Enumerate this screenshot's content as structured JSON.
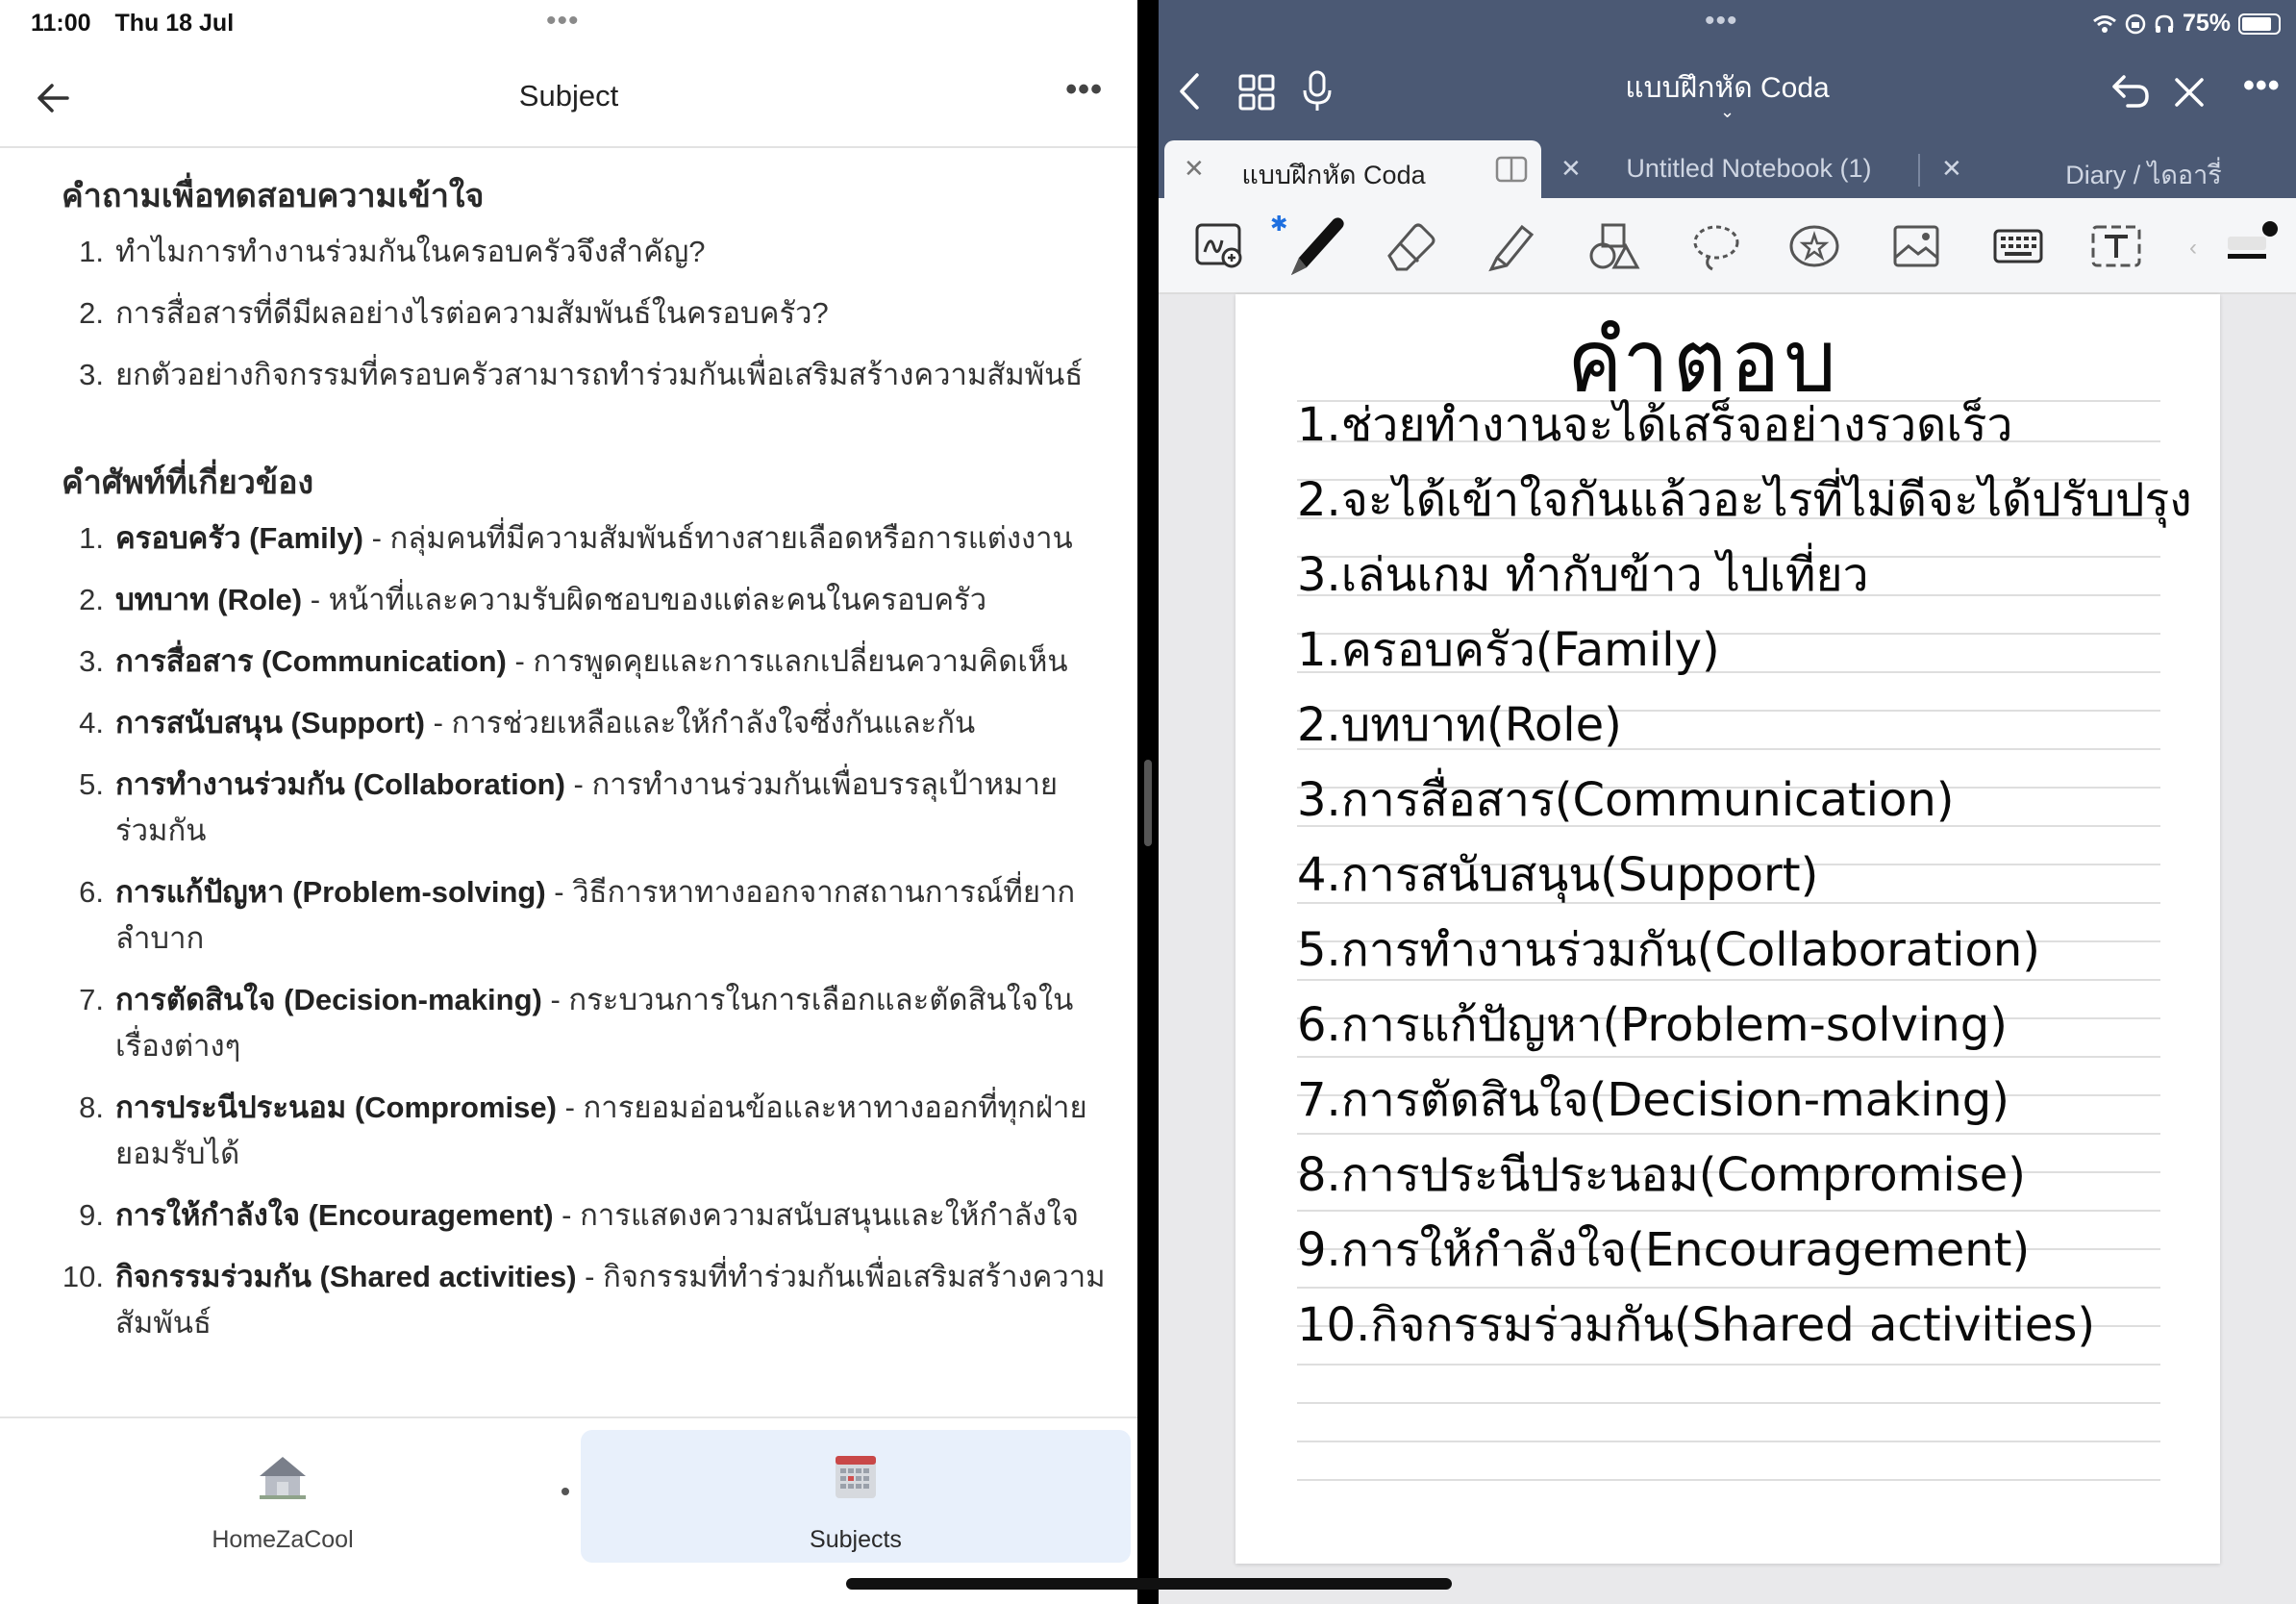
{
  "status_bar": {
    "time": "11:00",
    "date": "Thu 18 Jul",
    "battery": "75%"
  },
  "left_app": {
    "title": "Subject",
    "questions_heading": "คำถามเพื่อทดสอบความเข้าใจ",
    "questions": [
      {
        "num": "1.",
        "text": "ทำไมการทำงานร่วมกันในครอบครัวจึงสำคัญ?"
      },
      {
        "num": "2.",
        "text": "การสื่อสารที่ดีมีผลอย่างไรต่อความสัมพันธ์ในครอบครัว?"
      },
      {
        "num": "3.",
        "text": "ยกตัวอย่างกิจกรรมที่ครอบครัวสามารถทำร่วมกันเพื่อเสริมสร้างความสัมพันธ์"
      }
    ],
    "vocab_heading": "คำศัพท์ที่เกี่ยวข้อง",
    "vocab": [
      {
        "num": "1.",
        "term": "ครอบครัว (Family)",
        "def": " - กลุ่มคนที่มีความสัมพันธ์ทางสายเลือดหรือการแต่งงาน"
      },
      {
        "num": "2.",
        "term": "บทบาท (Role)",
        "def": " - หน้าที่และความรับผิดชอบของแต่ละคนในครอบครัว"
      },
      {
        "num": "3.",
        "term": "การสื่อสาร (Communication)",
        "def": " - การพูดคุยและการแลกเปลี่ยนความคิดเห็น"
      },
      {
        "num": "4.",
        "term": "การสนับสนุน (Support)",
        "def": " - การช่วยเหลือและให้กำลังใจซึ่งกันและกัน"
      },
      {
        "num": "5.",
        "term": "การทำงานร่วมกัน (Collaboration)",
        "def": " - การทำงานร่วมกันเพื่อบรรลุเป้าหมายร่วมกัน"
      },
      {
        "num": "6.",
        "term": "การแก้ปัญหา (Problem-solving)",
        "def": " - วิธีการหาทางออกจากสถานการณ์ที่ยากลำบาก"
      },
      {
        "num": "7.",
        "term": "การตัดสินใจ (Decision-making)",
        "def": " - กระบวนการในการเลือกและตัดสินใจในเรื่องต่างๆ"
      },
      {
        "num": "8.",
        "term": "การประนีประนอม (Compromise)",
        "def": " - การยอมอ่อนข้อและหาทางออกที่ทุกฝ่ายยอมรับได้"
      },
      {
        "num": "9.",
        "term": "การให้กำลังใจ (Encouragement)",
        "def": " - การแสดงความสนับสนุนและให้กำลังใจ"
      },
      {
        "num": "10.",
        "term": "กิจกรรมร่วมกัน (Shared activities)",
        "def": " - กิจกรรมที่ทำร่วมกันเพื่อเสริมสร้างความสัมพันธ์"
      }
    ],
    "tabbar": {
      "home_label": "HomeZaCool",
      "subjects_label": "Subjects"
    }
  },
  "right_app": {
    "notebook_title": "แบบฝึกหัด Coda",
    "tabs": [
      {
        "label": "แบบฝึกหัด Coda",
        "active": true
      },
      {
        "label": "Untitled Notebook (1)",
        "active": false
      },
      {
        "label": "Diary / ไดอารี่",
        "active": false
      }
    ],
    "handwriting_title": "คำตอบ",
    "handwriting_lines": [
      "1.ช่วยทำงานจะได้เสร็จอย่างรวดเร็ว",
      "2.จะได้เข้าใจกันแล้วอะไรที่ไม่ดีจะได้ปรับปรุง",
      "3.เล่นเกม   ทำกับข้าว  ไปเที่ยว",
      "1.ครอบครัว(Family)",
      "2.บทบาท(Role)",
      "3.การสื่อสาร(Communication)",
      "4.การสนับสนุน(Support)",
      "5.การทำงานร่วมกัน(Collaboration)",
      "6.การแก้ปัญหา(Problem-solving)",
      "7.การตัดสินใจ(Decision-making)",
      "8.การประนีประนอม(Compromise)",
      "9.การให้กำลังใจ(Encouragement)",
      "10.กิจกรรมร่วมกัน(Shared activities)"
    ],
    "accent_color": "#4b5974"
  }
}
